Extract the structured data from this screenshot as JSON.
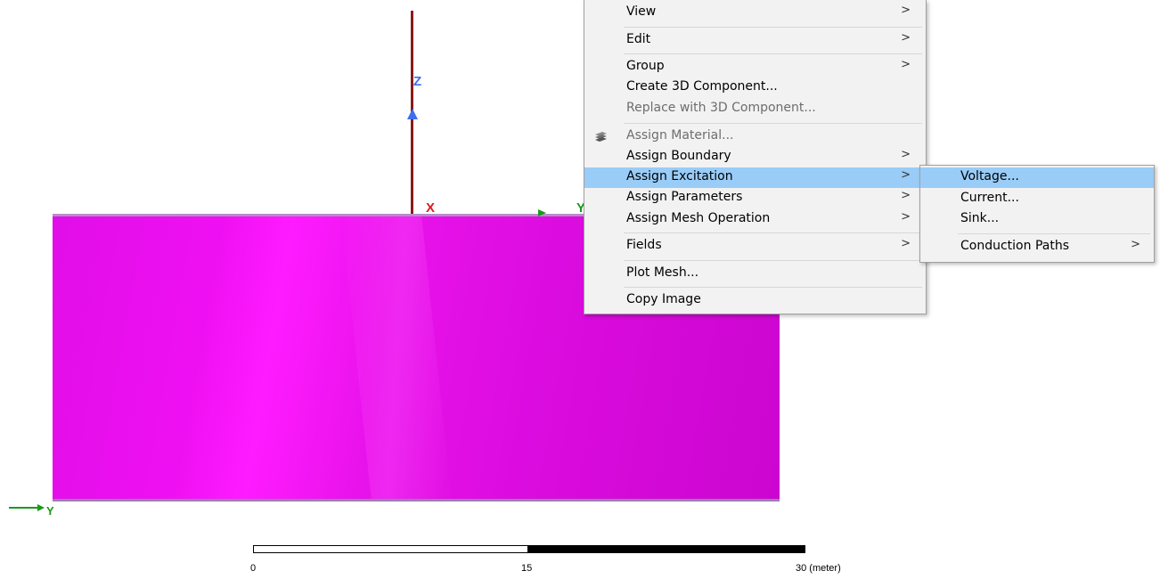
{
  "context_menu": {
    "items": [
      {
        "label": "View",
        "submenu": true,
        "disabled": false,
        "highlighted": false
      },
      {
        "label": "Edit",
        "submenu": true,
        "disabled": false,
        "highlighted": false
      },
      {
        "label": "Group",
        "submenu": true,
        "disabled": false,
        "highlighted": false
      },
      {
        "label": "Create 3D Component...",
        "submenu": false,
        "disabled": false,
        "highlighted": false
      },
      {
        "label": "Replace with 3D Component...",
        "submenu": false,
        "disabled": true,
        "highlighted": false
      },
      {
        "label": "Assign Material...",
        "submenu": false,
        "disabled": true,
        "highlighted": false,
        "icon": "material-icon"
      },
      {
        "label": "Assign Boundary",
        "submenu": true,
        "disabled": false,
        "highlighted": false
      },
      {
        "label": "Assign Excitation",
        "submenu": true,
        "disabled": false,
        "highlighted": true
      },
      {
        "label": "Assign Parameters",
        "submenu": true,
        "disabled": false,
        "highlighted": false
      },
      {
        "label": "Assign Mesh Operation",
        "submenu": true,
        "disabled": false,
        "highlighted": false
      },
      {
        "label": "Fields",
        "submenu": true,
        "disabled": false,
        "highlighted": false
      },
      {
        "label": "Plot Mesh...",
        "submenu": false,
        "disabled": false,
        "highlighted": false
      },
      {
        "label": "Copy Image",
        "submenu": false,
        "disabled": false,
        "highlighted": false
      }
    ],
    "arrow_glyph": ">"
  },
  "submenu": {
    "items": [
      {
        "label": "Voltage...",
        "submenu": false,
        "highlighted": true
      },
      {
        "label": "Current...",
        "submenu": false,
        "highlighted": false
      },
      {
        "label": "Sink...",
        "submenu": false,
        "highlighted": false
      },
      {
        "label": "Conduction Paths",
        "submenu": true,
        "highlighted": false
      }
    ]
  },
  "viewport": {
    "axes": {
      "z": "Z",
      "x": "X",
      "y": "Y"
    },
    "triad_label": "Y",
    "model_color": "#e812ea"
  },
  "scale_bar": {
    "ticks": [
      "0",
      "15",
      "30 (meter)"
    ]
  },
  "colors": {
    "menu_background": "#f2f2f2",
    "menu_highlight": "#99ccf7",
    "disabled_text": "#6d6d6d",
    "z_axis": "#3f6ff0",
    "x_axis": "#e01a1a",
    "y_axis": "#1a9a1a"
  }
}
